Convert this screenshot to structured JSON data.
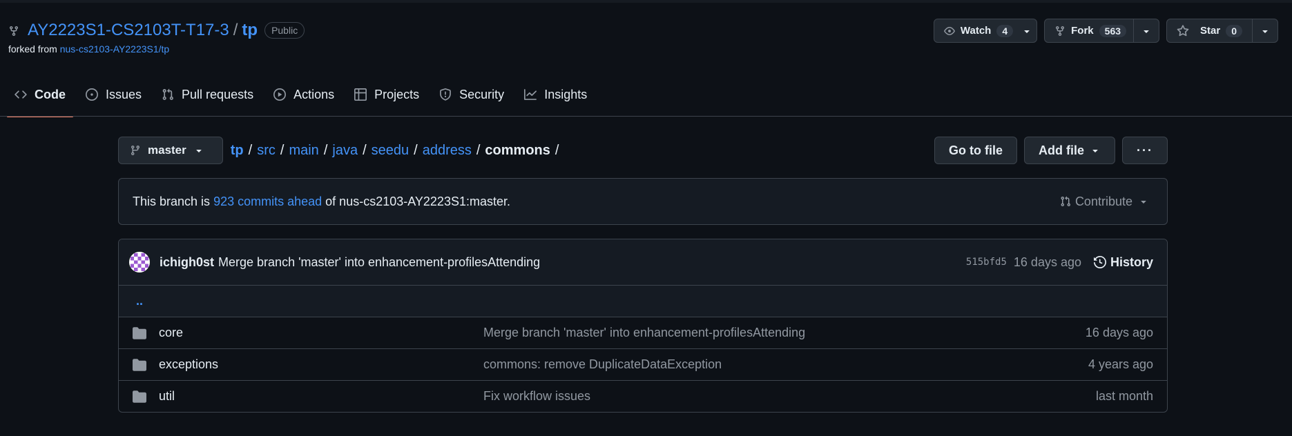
{
  "repo": {
    "owner": "AY2223S1-CS2103T-T17-3",
    "separator": "/",
    "name": "tp",
    "visibility": "Public",
    "forked_from_label": "forked from",
    "forked_from_link": "nus-cs2103-AY2223S1/tp"
  },
  "actions": {
    "watch_label": "Watch",
    "watch_count": "4",
    "fork_label": "Fork",
    "fork_count": "563",
    "star_label": "Star",
    "star_count": "0"
  },
  "tabs": [
    {
      "label": "Code",
      "icon": "code-icon"
    },
    {
      "label": "Issues",
      "icon": "issue-icon"
    },
    {
      "label": "Pull requests",
      "icon": "pull-request-icon"
    },
    {
      "label": "Actions",
      "icon": "play-icon"
    },
    {
      "label": "Projects",
      "icon": "table-icon"
    },
    {
      "label": "Security",
      "icon": "shield-icon"
    },
    {
      "label": "Insights",
      "icon": "graph-icon"
    }
  ],
  "branch": {
    "name": "master"
  },
  "breadcrumb": {
    "parts": [
      "tp",
      "src",
      "main",
      "java",
      "seedu",
      "address"
    ],
    "current": "commons",
    "sep": "/"
  },
  "path_actions": {
    "go_to_file": "Go to file",
    "add_file": "Add file",
    "more": "···"
  },
  "branch_status": {
    "prefix": "This branch is",
    "link": "923 commits ahead",
    "suffix": "of nus-cs2103-AY2223S1:master.",
    "contribute": "Contribute"
  },
  "latest_commit": {
    "author": "ichigh0st",
    "message": "Merge branch 'master' into enhancement-profilesAttending",
    "sha": "515bfd5",
    "time": "16 days ago",
    "history": "History"
  },
  "updir": "..",
  "files": [
    {
      "name": "core",
      "message": "Merge branch 'master' into enhancement-profilesAttending",
      "time": "16 days ago"
    },
    {
      "name": "exceptions",
      "message": "commons: remove DuplicateDataException",
      "time": "4 years ago"
    },
    {
      "name": "util",
      "message": "Fix workflow issues",
      "time": "last month"
    }
  ],
  "colors": {
    "background": "#0d1117",
    "link": "#4493f8",
    "muted": "#9198a1",
    "border": "#3d444d",
    "active_tab_underline": "#f78166"
  }
}
